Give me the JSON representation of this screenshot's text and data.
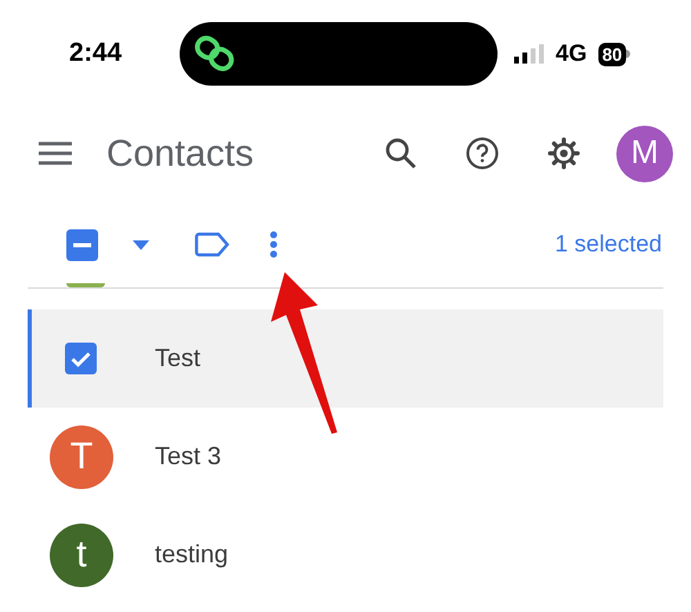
{
  "status_bar": {
    "time": "2:44",
    "network": "4G",
    "battery": "80"
  },
  "header": {
    "title": "Contacts",
    "account_initial": "M"
  },
  "toolbar": {
    "select_all": {
      "indeterminate": true
    },
    "selection_count": "1 selected"
  },
  "contacts": [
    {
      "name": "Test",
      "selected": true
    },
    {
      "name": "Test 3",
      "selected": false,
      "initial": "T",
      "color": "#e2603a"
    },
    {
      "name": "testing",
      "selected": false,
      "initial": "t",
      "color": "#41692a"
    }
  ]
}
